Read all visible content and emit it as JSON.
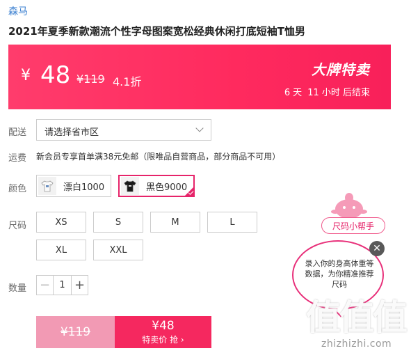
{
  "brand": "森马",
  "product_title": "2021年夏季新款潮流个性字母图案宽松经典休闲打底短袖T恤男",
  "price_banner": {
    "currency": "¥",
    "price": "48",
    "original_price": "¥119",
    "discount": "4.1折",
    "sale_title": "大牌特卖",
    "countdown": {
      "days": "6",
      "days_unit": "天",
      "hours": "11",
      "hours_unit": "小时",
      "suffix": "后结束"
    }
  },
  "delivery": {
    "label": "配送",
    "placeholder": "请选择省市区"
  },
  "shipping": {
    "label": "运费",
    "text": "新会员专享首单满38元免邮（限唯品自营商品，部分商品不可用）"
  },
  "color": {
    "label": "颜色",
    "options": [
      {
        "label": "漂白1000",
        "selected": false,
        "swatch": "#ffffff"
      },
      {
        "label": "黑色9000",
        "selected": true,
        "swatch": "#1a1a1a"
      }
    ]
  },
  "size": {
    "label": "尺码",
    "options": [
      "XS",
      "S",
      "M",
      "L",
      "XL",
      "XXL"
    ]
  },
  "quantity": {
    "label": "数量",
    "value": "1",
    "minus": "−",
    "plus": "+"
  },
  "buy_bar": {
    "original_price": "¥119",
    "sale_price": "¥48",
    "cta": "特卖价 抢 ›"
  },
  "size_helper": {
    "tag": "尺码小帮手",
    "bubble_text": "录入你的身高体重等数据，为你精准推荐尺码",
    "close": "✕"
  },
  "watermark": {
    "logo": "值值值",
    "url": "zhizhizhi.com"
  },
  "colors": {
    "accent": "#ff2a5e",
    "link": "#3a7fd0",
    "border_selected": "#e6246a"
  }
}
